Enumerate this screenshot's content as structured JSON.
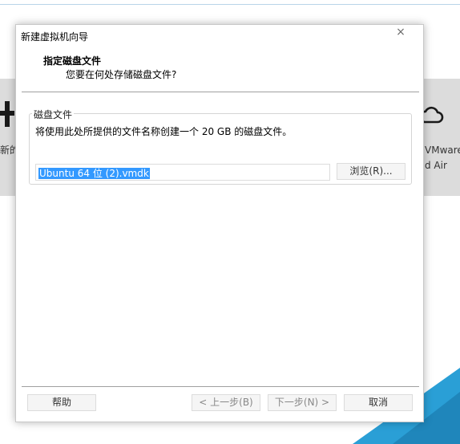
{
  "background": {
    "left_label": "新的",
    "right_label_lines": [
      "VMware",
      "d Air"
    ],
    "icons": [
      "plus-icon",
      "cloud-icon"
    ]
  },
  "dialog": {
    "title": "新建虚拟机向导",
    "close_symbol": "×",
    "header": {
      "title": "指定磁盘文件",
      "subtitle": "您要在何处存储磁盘文件?"
    },
    "disk_file_group": {
      "legend": "磁盘文件",
      "description": "将使用此处所提供的文件名称创建一个 20 GB 的磁盘文件。",
      "filename_value": "Ubuntu 64 位 (2).vmdk",
      "browse_label": "浏览(R)..."
    },
    "buttons": {
      "help": "帮助",
      "back": "< 上一步(B)",
      "next": "下一步(N) >",
      "cancel": "取消"
    }
  },
  "colors": {
    "selection": "#3399ff",
    "band_gray": "#dcdcdc",
    "accent_teal": "#2a9fd6"
  }
}
